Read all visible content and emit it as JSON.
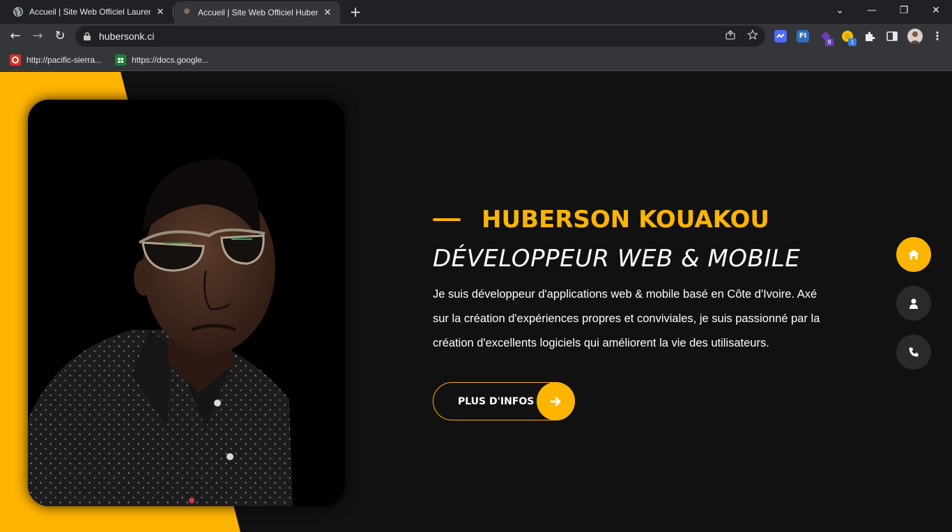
{
  "browser": {
    "tabs": [
      {
        "title": "Accueil | Site Web Officiel Lauren",
        "active": false
      },
      {
        "title": "Accueil | Site Web Officiel Hubers",
        "active": true
      }
    ],
    "tab_close_glyph": "✕",
    "new_tab_glyph": "+",
    "window_controls": [
      "⌄",
      "—",
      "❐",
      "✕"
    ],
    "nav": {
      "back": "←",
      "forward": "→",
      "reload": "↻"
    },
    "url": "hubersonk.ci",
    "omnibox_icons": [
      "share-icon",
      "star-icon"
    ],
    "extensions": [
      {
        "name": "extension-icon-1",
        "color": "#4f6bff",
        "text": "",
        "badge": ""
      },
      {
        "name": "extension-icon-2",
        "color": "#2f6fb6",
        "text": "FI",
        "badge": ""
      },
      {
        "name": "extension-icon-3",
        "color": "#6a3fb5",
        "text": "",
        "badge": "8"
      },
      {
        "name": "extension-icon-4",
        "color": "#f2c200",
        "text": "",
        "badge": "1"
      }
    ],
    "bookmarks": [
      {
        "label": "http://pacific-sierra...",
        "icon_color": "#d93025"
      },
      {
        "label": "https://docs.google...",
        "icon_color": "#188038"
      }
    ]
  },
  "hero": {
    "name": "HUBERSON KOUAKOU",
    "role": "DÉVELOPPEUR WEB & MOBILE",
    "intro": "Je suis développeur d'applications web & mobile basé en Côte d'Ivoire. Axé sur la création d'expériences propres et conviviales, je suis passionné par la création d'excellents logiciels qui améliorent la vie des utilisateurs.",
    "more_button": "PLUS D'INFOS"
  },
  "side_nav": [
    {
      "name": "home",
      "active": true
    },
    {
      "name": "about",
      "active": false
    },
    {
      "name": "contact",
      "active": false
    }
  ],
  "colors": {
    "accent": "#ffb400",
    "background": "#111111",
    "nav_inactive": "#2b2a2a"
  }
}
